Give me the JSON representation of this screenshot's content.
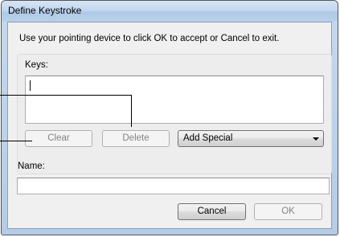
{
  "window": {
    "title": "Define Keystroke"
  },
  "instruction": "Use your pointing device to click OK to accept or Cancel to exit.",
  "keys": {
    "label": "Keys:",
    "value": ""
  },
  "buttons": {
    "clear": "Clear",
    "delete": "Delete",
    "cancel": "Cancel",
    "ok": "OK"
  },
  "add_special": {
    "selected": "Add Special"
  },
  "name": {
    "label": "Name:",
    "value": ""
  }
}
